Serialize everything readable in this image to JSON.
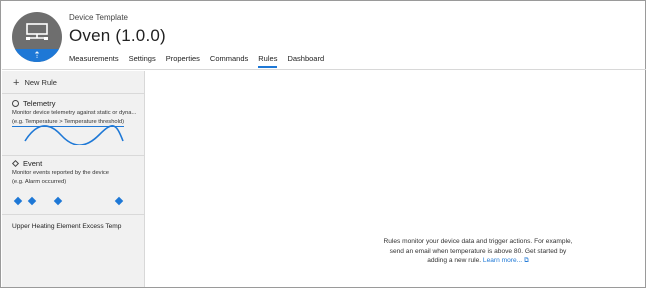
{
  "header": {
    "template_label": "Device Template",
    "device_title": "Oven (1.0.0)",
    "avatar_icon": "device-monitor-icon",
    "avatar_badge_icon": "upload-arrow-icon",
    "tabs": [
      {
        "label": "Measurements",
        "active": false
      },
      {
        "label": "Settings",
        "active": false
      },
      {
        "label": "Properties",
        "active": false
      },
      {
        "label": "Commands",
        "active": false
      },
      {
        "label": "Rules",
        "active": true
      },
      {
        "label": "Dashboard",
        "active": false
      }
    ]
  },
  "sidebar": {
    "new_rule_label": "New Rule",
    "telemetry": {
      "title": "Telemetry",
      "description": "Monitor device telemetry against static or dyna...",
      "example": "(e.g. Temperature > Temperature threshold)",
      "icon": "circle-icon"
    },
    "event": {
      "title": "Event",
      "description": "Monitor events reported by the device",
      "example": "(e.g. Alarm occurred)",
      "icon": "diamond-icon"
    },
    "rules": [
      {
        "label": "Upper Heating Element Excess Temp"
      }
    ]
  },
  "main": {
    "empty_line1": "Rules monitor your device data and trigger actions. For example,",
    "empty_line2": "send an email when temperature is above 80. Get started by",
    "empty_line3": "adding a new rule.",
    "learn_more": "Learn more...",
    "external_icon": "external-link-icon"
  },
  "colors": {
    "accent": "#1e78d6",
    "avatar_bg": "#6e6e6e",
    "sidebar_bg": "#f1f1f1"
  }
}
